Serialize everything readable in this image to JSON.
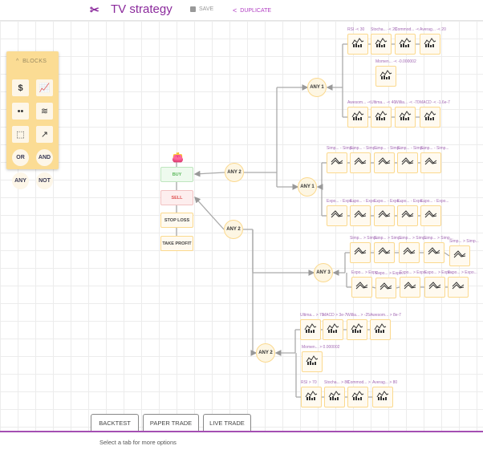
{
  "header": {
    "title": "TV strategy",
    "save_label": "SAVE",
    "duplicate_label": "DUPLICATE",
    "logo_icon": "link-icon"
  },
  "blocks": {
    "title": "BLOCKS",
    "icons": [
      "dollar-icon",
      "bar-chart-icon",
      "paws-icon",
      "crossing-lines-icon",
      "cube-icon",
      "trend-up-icon"
    ],
    "gates": [
      "OR",
      "AND",
      "ANY",
      "NOT"
    ]
  },
  "actions": {
    "buy": "BUY",
    "sell": "SELL",
    "stop_loss": "STOP LOSS",
    "take_profit": "TAKE PROFIT"
  },
  "colors": {
    "accent": "#8b2a9c",
    "block_bg": "#fbdc94",
    "buy": "#5cb85c",
    "sell": "#e05555"
  },
  "gates": [
    {
      "label": "ANY 2"
    },
    {
      "label": "ANY 2"
    },
    {
      "label": "ANY 1"
    },
    {
      "label": "ANY 1"
    },
    {
      "label": "ANY 3"
    },
    {
      "label": "ANY 2"
    }
  ],
  "groups": [
    {
      "nodes": [
        "RSI -< 30",
        "Stocha... -< 20",
        "Commod... -<",
        "Averag... -< 20",
        "Momen... -< -0.000002",
        "Awesom... -<",
        "Ultima... -< 40",
        "Willia... -< -70",
        "MACD -< -1.6e-7"
      ]
    },
    {
      "nodes": [
        "Simp... - Simp...",
        "Simp... - Simp...",
        "Simp... - Simp...",
        "Simp... - Simp...",
        "Simp... - Simp...",
        "Expo... - Expo...",
        "Expo... - Expo...",
        "Expo... - Expo...",
        "Expo... - Expo...",
        "Expo... - Expo..."
      ]
    },
    {
      "nodes": [
        "Simp... > Simp...",
        "Simp... > Simp...",
        "Simp... > Simp...",
        "Simp... > Simp...",
        "Simp... > Simp...",
        "Expo... > Expo...",
        "Expo... > Expo...",
        "Expo... > Expo...",
        "Expo... > Expo...",
        "Expo... > Expo..."
      ]
    },
    {
      "nodes": [
        "Ultima... > 70",
        "MACD > 3e-7",
        "Willia... > -25",
        "Awesom... > 8e-7",
        "Momen... > 0.000002",
        "RSI > 70",
        "Stocha... > 80",
        "Commod... >",
        "Averag... > 80"
      ]
    }
  ],
  "tabs": [
    {
      "label": "BACKTEST"
    },
    {
      "label": "PAPER TRADE"
    },
    {
      "label": "LIVE TRADE"
    }
  ],
  "hint": "Select a tab for more options"
}
